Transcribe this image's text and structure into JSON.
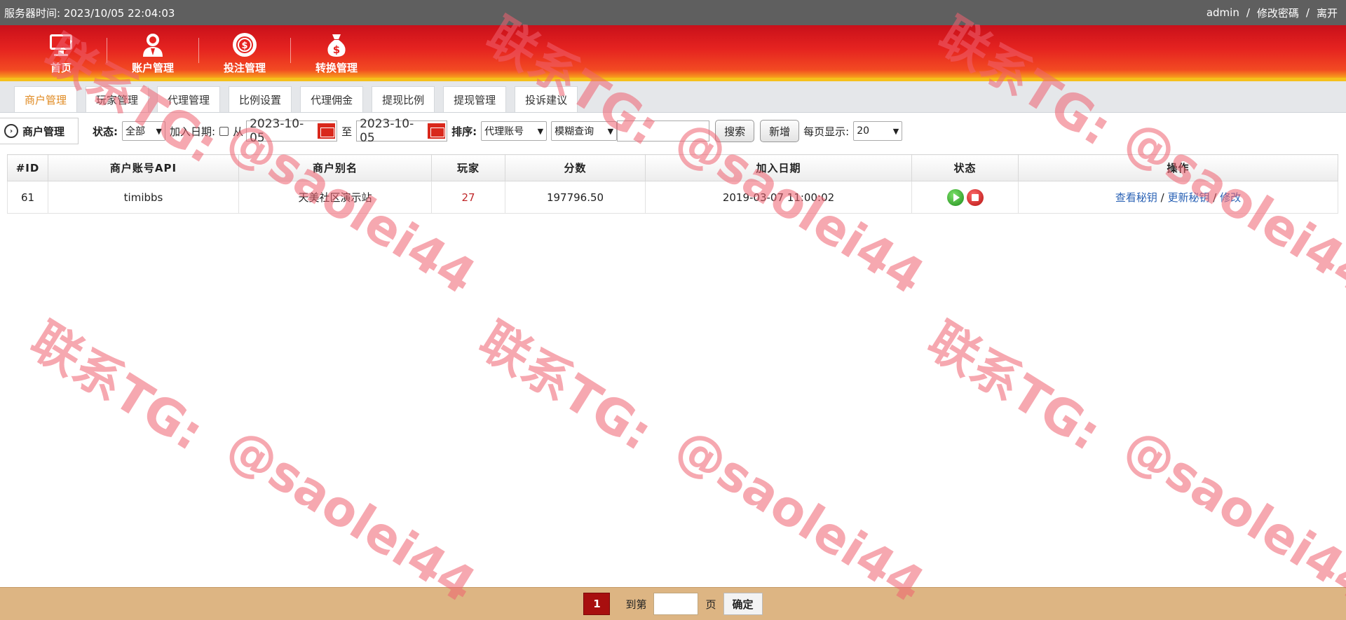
{
  "topbar": {
    "server_time_label": "服务器时间:",
    "server_time": "2023/10/05 22:04:03",
    "user": "admin",
    "sep": "/",
    "change_password": "修改密碼",
    "logout": "离开"
  },
  "nav": {
    "items": [
      {
        "label": "首页",
        "icon": "monitor-icon"
      },
      {
        "label": "账户管理",
        "icon": "user-icon"
      },
      {
        "label": "投注管理",
        "icon": "casino-chip-icon"
      },
      {
        "label": "转换管理",
        "icon": "money-bag-icon"
      }
    ]
  },
  "tabs": [
    "商户管理",
    "玩家管理",
    "代理管理",
    "比例设置",
    "代理佣金",
    "提现比例",
    "提现管理",
    "投诉建议"
  ],
  "toolbar": {
    "section_title": "商户管理",
    "status_label": "状态:",
    "status_value": "全部",
    "join_date_label": "加入日期:",
    "from_label": "从",
    "date_from": "2023-10-05",
    "to_label": "至",
    "date_to": "2023-10-05",
    "sort_label": "排序:",
    "sort_value": "代理账号",
    "query_mode": "模糊查询",
    "search_button": "搜索",
    "add_button": "新增",
    "per_page_label": "每页显示:",
    "per_page_value": "20"
  },
  "table": {
    "headers": [
      "#ID",
      "商户账号API",
      "商户别名",
      "玩家",
      "分数",
      "加入日期",
      "状态",
      "操作"
    ],
    "rows": [
      {
        "id": "61",
        "api": "timibbs",
        "alias": "天美社区演示站",
        "players": "27",
        "score": "197796.50",
        "joined": "2019-03-07 11:00:02",
        "actions": [
          "查看秘钥",
          "更新秘钥",
          "修改"
        ],
        "action_sep": "/"
      }
    ]
  },
  "pagination": {
    "current_page": "1",
    "goto_label": "到第",
    "page_label": "页",
    "confirm_button": "确定"
  },
  "watermark": {
    "line1": "联系TG:",
    "line2": "@saolei44"
  },
  "colors": {
    "accent_red": "#c9101a",
    "tab_active": "#e08a21",
    "link": "#2a62b5",
    "footer_bg": "#ddb583",
    "watermark": "#ee6070"
  }
}
